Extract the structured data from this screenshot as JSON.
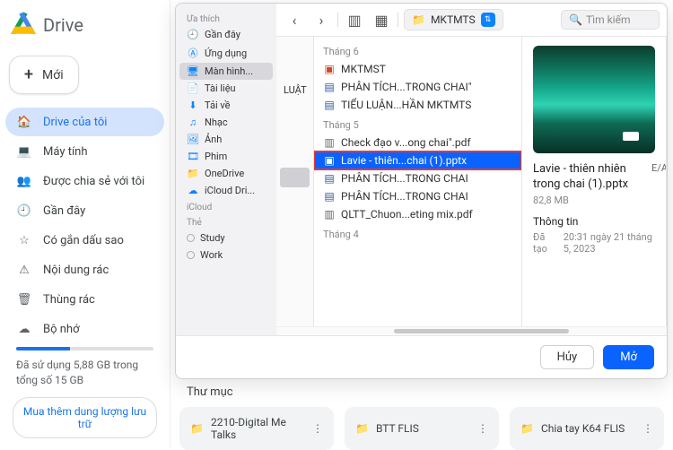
{
  "drive": {
    "title": "Drive",
    "new_label": "Mới",
    "nav": [
      {
        "icon": "home",
        "label": "Drive của tôi",
        "active": true
      },
      {
        "icon": "devices",
        "label": "Máy tính"
      },
      {
        "icon": "people",
        "label": "Được chia sẻ với tôi"
      },
      {
        "icon": "clock",
        "label": "Gần đây"
      },
      {
        "icon": "star",
        "label": "Có gắn dấu sao"
      },
      {
        "icon": "spam",
        "label": "Nội dung rác"
      },
      {
        "icon": "trash",
        "label": "Thùng rác"
      },
      {
        "icon": "cloud",
        "label": "Bộ nhớ"
      }
    ],
    "storage_text": "Đã sử dụng 5,88 GB trong tổng số 15 GB",
    "buy_more": "Mua thêm dung lượng lưu trữ"
  },
  "bg": {
    "section_label": "Thư mục",
    "folders": [
      "2210-Digital Me Talks",
      "BTT FLIS",
      "Chia tay K64 FLIS"
    ]
  },
  "dialog": {
    "sidebar": {
      "fav_header": "Ưa thích",
      "favorites": [
        {
          "icon": "clock",
          "label": "Gần đây"
        },
        {
          "icon": "app",
          "label": "Ứng dụng"
        },
        {
          "icon": "desktop",
          "label": "Màn hình...",
          "selected": true
        },
        {
          "icon": "doc",
          "label": "Tài liệu"
        },
        {
          "icon": "download",
          "label": "Tải về"
        },
        {
          "icon": "music",
          "label": "Nhạc"
        },
        {
          "icon": "image",
          "label": "Ảnh"
        },
        {
          "icon": "film",
          "label": "Phim"
        },
        {
          "icon": "folder",
          "label": "OneDrive"
        },
        {
          "icon": "icloud",
          "label": "iCloud Dri..."
        }
      ],
      "icloud_header": "iCloud",
      "tags_header": "Thẻ",
      "tags": [
        "Study",
        "Work"
      ]
    },
    "toolbar": {
      "path": "MKTMTS",
      "search_placeholder": "Tìm kiếm"
    },
    "groups": [
      {
        "label": "Tháng 6",
        "files": [
          {
            "type": "ppt",
            "name": "MKTMST"
          },
          {
            "type": "wd",
            "name": "PHÂN TÍCH...TRONG CHAI\""
          },
          {
            "type": "wd",
            "name": "TIỂU LUẬN...HẦN MKTMTS"
          }
        ]
      },
      {
        "label": "Tháng 5",
        "files": [
          {
            "type": "pdf",
            "name": "Check đạo v...ong chai\".pdf"
          },
          {
            "type": "ppt",
            "name": "Lavie - thiên...chai (1).pptx",
            "selected": true
          },
          {
            "type": "wd",
            "name": "PHÂN TÍCH...TRONG CHAI"
          },
          {
            "type": "wd",
            "name": "PHÂN TÍCH...TRONG CHAI"
          },
          {
            "type": "pdf",
            "name": "QLTT_Chuon...eting mix.pdf"
          }
        ]
      },
      {
        "label": "Tháng 4",
        "files": []
      }
    ],
    "col1_stub": "LUẬT",
    "preview": {
      "title": "Lavie - thiên nhiên trong chai (1).pptx",
      "size": "82,8 MB",
      "info_header": "Thông tin",
      "created_label": "Đã tạo",
      "created_value": "20:31 ngày 21 tháng 5, 2023",
      "ea": "E/A"
    },
    "buttons": {
      "cancel": "Hủy",
      "open": "Mở"
    }
  }
}
